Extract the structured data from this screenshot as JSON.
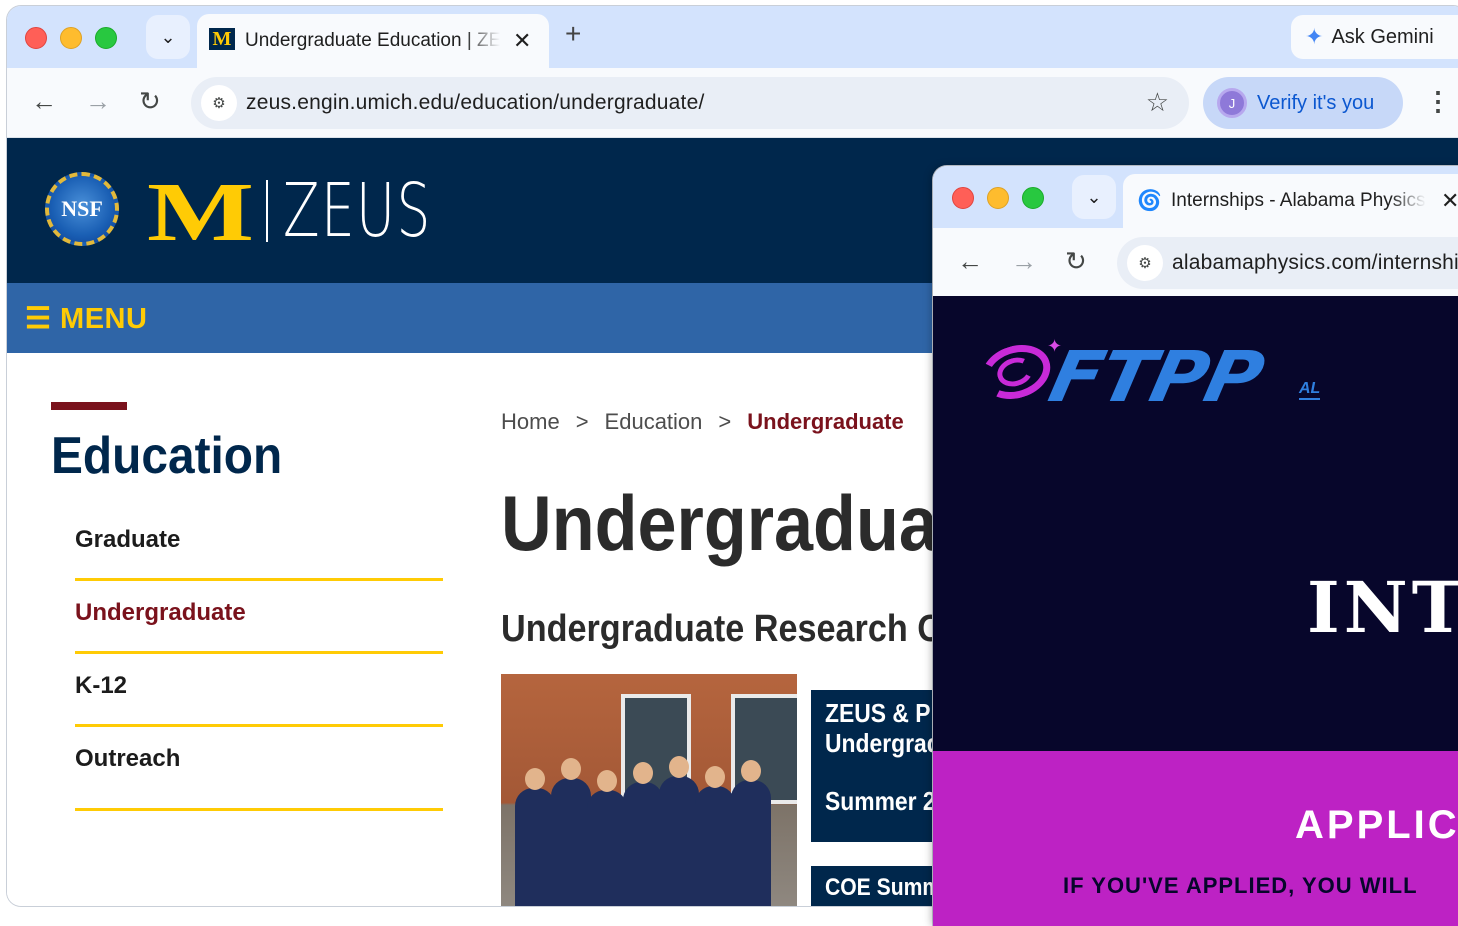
{
  "main_window": {
    "tab": {
      "title": "Undergraduate Education | ZEUS",
      "favicon": "M"
    },
    "gemini_label": "Ask Gemini",
    "url": "zeus.engin.umich.edu/education/undergraduate/",
    "verify_label": "Verify it's you",
    "avatar_letter": "J"
  },
  "zeus_page": {
    "nsf_label": "NSF",
    "m_logo": "M",
    "site_name": "ZEUS",
    "menu_label": "☰ MENU",
    "sidebar": {
      "title": "Education",
      "items": [
        {
          "label": "Graduate"
        },
        {
          "label": "Undergraduate"
        },
        {
          "label": "K-12"
        },
        {
          "label": "Outreach"
        }
      ]
    },
    "breadcrumbs": {
      "home": "Home",
      "sep": ">",
      "parent": "Education",
      "current": "Undergraduate"
    },
    "heading": "Undergraduate",
    "subheading": "Undergraduate Research Opportunities",
    "card1": {
      "line1": "ZEUS & PI",
      "line2": "Undergraduate",
      "line3": "Summer 2"
    },
    "card2": {
      "line1": "COE Summer"
    }
  },
  "popup_window": {
    "tab": {
      "title": "Internships - Alabama Physics"
    },
    "url": "alabamaphysics.com/internships",
    "page": {
      "logo_text": "FTPP",
      "logo_sub": "AL",
      "hero_text": "INTERNSHIPS",
      "apply_text": "APPLICATIONS",
      "apply_sub": "IF YOU'VE APPLIED, YOU WILL"
    }
  },
  "colors": {
    "umich_blue": "#00274c",
    "umich_maize": "#ffcb05",
    "menu_blue": "#2f65a7",
    "accent_red": "#7a121c",
    "ftpp_navy": "#07062b",
    "ftpp_magenta": "#bd22c4"
  },
  "icons": [
    "close-icon",
    "minimize-icon",
    "zoom-icon",
    "chevron-down-icon",
    "plus-icon",
    "gemini-sparkle-icon",
    "back-arrow-icon",
    "forward-arrow-icon",
    "reload-icon",
    "site-settings-icon",
    "star-icon",
    "kebab-menu-icon",
    "galaxy-icon"
  ]
}
